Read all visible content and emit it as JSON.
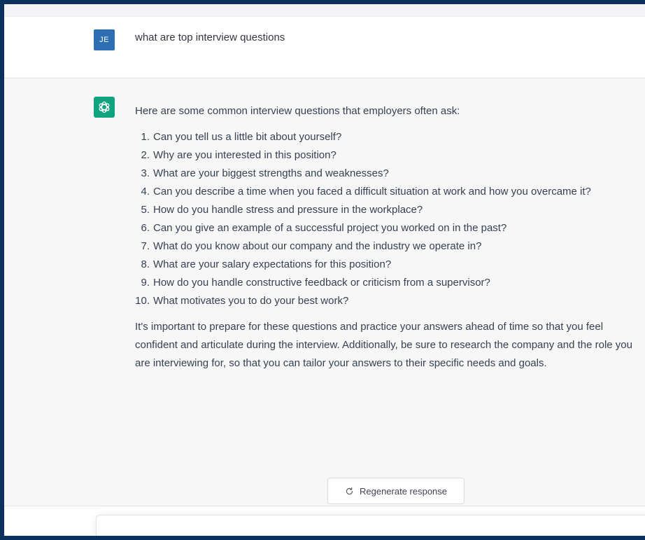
{
  "user_message": {
    "avatar_initials": "JE",
    "text": "what are top interview questions"
  },
  "assistant_message": {
    "intro": "Here are some common interview questions that employers often ask:",
    "questions": [
      {
        "num": "1.",
        "text": "Can you tell us a little bit about yourself?"
      },
      {
        "num": "2.",
        "text": "Why are you interested in this position?"
      },
      {
        "num": "3.",
        "text": "What are your biggest strengths and weaknesses?"
      },
      {
        "num": "4.",
        "text": "Can you describe a time when you faced a difficult situation at work and how you overcame it?"
      },
      {
        "num": "5.",
        "text": "How do you handle stress and pressure in the workplace?"
      },
      {
        "num": "6.",
        "text": "Can you give an example of a successful project you worked on in the past?"
      },
      {
        "num": "7.",
        "text": "What do you know about our company and the industry we operate in?"
      },
      {
        "num": "8.",
        "text": "What are your salary expectations for this position?"
      },
      {
        "num": "9.",
        "text": "How do you handle constructive feedback or criticism from a supervisor?"
      },
      {
        "num": "10.",
        "text": "What motivates you to do your best work?"
      }
    ],
    "outro": "It's important to prepare for these questions and practice your answers ahead of time so that you feel confident and articulate during the interview. Additionally, be sure to research the company and the role you are interviewing for, so that you can tailor your answers to their specific needs and goals."
  },
  "regenerate_label": "Regenerate response",
  "icons": {
    "user_avatar": "user-avatar",
    "assistant_avatar": "openai-logo-icon",
    "regenerate": "refresh-icon"
  },
  "colors": {
    "frame_border": "#0b2f5e",
    "user_avatar_bg": "#2e6fb4",
    "assistant_avatar_bg": "#10a37f",
    "assistant_row_bg": "#f7f7f8"
  }
}
